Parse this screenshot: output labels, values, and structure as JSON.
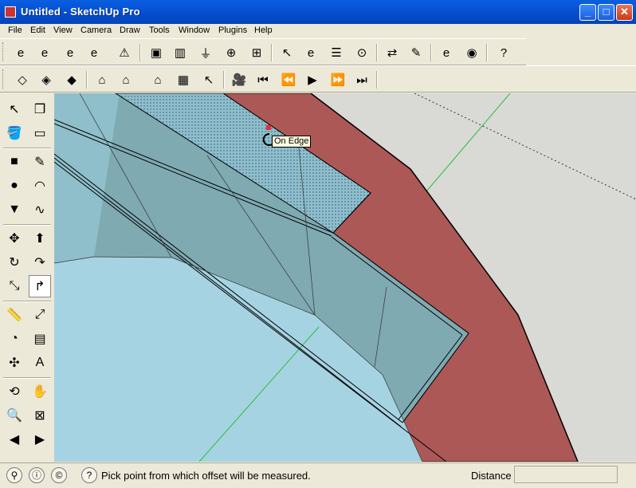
{
  "window": {
    "title": "Untitled - SketchUp Pro",
    "minimize_glyph": "_",
    "maximize_glyph": "□",
    "close_glyph": "✕"
  },
  "menu": [
    "File",
    "Edit",
    "View",
    "Camera",
    "Draw",
    "Tools",
    "Window",
    "Plugins",
    "Help"
  ],
  "toolbar1": [
    {
      "name": "ie-export-icon",
      "glyph": "e"
    },
    {
      "name": "components-export-icon",
      "glyph": "e"
    },
    {
      "name": "save-e-icon",
      "glyph": "e"
    },
    {
      "name": "save-as-e-icon",
      "glyph": "e"
    },
    {
      "name": "warning-icon",
      "glyph": "⚠"
    },
    {
      "name": "component-box-icon",
      "glyph": "▣"
    },
    {
      "name": "component-axes-icon",
      "glyph": "▥"
    },
    {
      "name": "plug-icon",
      "glyph": "⏚"
    },
    {
      "name": "target-cc-icon",
      "glyph": "⊕"
    },
    {
      "name": "grid-rm-icon",
      "glyph": "⊞"
    },
    {
      "name": "pointer-help-icon",
      "glyph": "↖"
    },
    {
      "name": "browser-e-icon",
      "glyph": "e"
    },
    {
      "name": "window-list-icon",
      "glyph": "☰"
    },
    {
      "name": "binoculars-icon",
      "glyph": "⊙"
    },
    {
      "name": "swap-arrows-icon",
      "glyph": "⇄"
    },
    {
      "name": "wrench-icon",
      "glyph": "✎"
    },
    {
      "name": "ie-plus-icon",
      "glyph": "e"
    },
    {
      "name": "globe-icon",
      "glyph": "◉"
    },
    {
      "name": "help-icon",
      "glyph": "?"
    }
  ],
  "toolbar2": [
    {
      "name": "xray-cube-icon",
      "glyph": "◇"
    },
    {
      "name": "wire-cube-icon",
      "glyph": "◈"
    },
    {
      "name": "hidden-line-cube-icon",
      "glyph": "◆"
    },
    {
      "name": "house-shaded-icon",
      "glyph": "⌂"
    },
    {
      "name": "house-colored-icon",
      "glyph": "⌂"
    },
    {
      "name": "house-textured-icon",
      "glyph": "⌂"
    },
    {
      "name": "materials-grid-icon",
      "glyph": "▦"
    },
    {
      "name": "paint-select-icon",
      "glyph": "↖"
    },
    {
      "name": "movie-camera-icon",
      "glyph": "🎥"
    },
    {
      "name": "skip-first-icon",
      "glyph": "⏮"
    },
    {
      "name": "rewind-icon",
      "glyph": "⏪"
    },
    {
      "name": "play-icon",
      "glyph": "▶"
    },
    {
      "name": "fast-forward-icon",
      "glyph": "⏩"
    },
    {
      "name": "skip-last-icon",
      "glyph": "⏭"
    }
  ],
  "left_tools": [
    {
      "name": "select-tool-icon",
      "glyph": "↖"
    },
    {
      "name": "make-component-icon",
      "glyph": "❒"
    },
    {
      "name": "paint-bucket-icon",
      "glyph": "🪣"
    },
    {
      "name": "eraser-icon",
      "glyph": "▭"
    },
    {
      "name": "rectangle-tool-icon",
      "glyph": "■"
    },
    {
      "name": "pencil-line-icon",
      "glyph": "✎"
    },
    {
      "name": "circle-tool-icon",
      "glyph": "●"
    },
    {
      "name": "arc-tool-icon",
      "glyph": "◠"
    },
    {
      "name": "polygon-tool-icon",
      "glyph": "▼"
    },
    {
      "name": "freehand-tool-icon",
      "glyph": "∿"
    },
    {
      "name": "move-tool-icon",
      "glyph": "✥"
    },
    {
      "name": "push-pull-icon",
      "glyph": "⬆"
    },
    {
      "name": "rotate-tool-icon",
      "glyph": "↻"
    },
    {
      "name": "follow-me-icon",
      "glyph": "↷"
    },
    {
      "name": "scale-tool-icon",
      "glyph": "⤡"
    },
    {
      "name": "offset-tool-icon",
      "glyph": "↱"
    },
    {
      "name": "tape-measure-icon",
      "glyph": "📏"
    },
    {
      "name": "dimension-tool-icon",
      "glyph": "⤢"
    },
    {
      "name": "protractor-icon",
      "glyph": "◔"
    },
    {
      "name": "text-tool-icon",
      "glyph": "▤"
    },
    {
      "name": "axes-tool-icon",
      "glyph": "✣"
    },
    {
      "name": "3d-text-icon",
      "glyph": "A"
    },
    {
      "name": "orbit-tool-icon",
      "glyph": "⟲"
    },
    {
      "name": "pan-hand-icon",
      "glyph": "✋"
    },
    {
      "name": "zoom-tool-icon",
      "glyph": "🔍"
    },
    {
      "name": "zoom-window-icon",
      "glyph": "⊠"
    },
    {
      "name": "previous-view-icon",
      "glyph": "◀"
    },
    {
      "name": "next-view-icon",
      "glyph": "▶"
    }
  ],
  "viewport": {
    "tooltip": "On Edge"
  },
  "status": {
    "message": "Pick point from which offset will be measured.",
    "help_glyph": "?",
    "vcb_label": "Distance",
    "vcb_value": ""
  },
  "colors": {
    "wall_red": "#ac5857",
    "face_blue_light": "#a6d3e2",
    "face_blue_mid": "#8fbfcb",
    "face_teal": "#7faab2",
    "background": "#d9d9d6",
    "axis_green": "#2bbf3a"
  }
}
